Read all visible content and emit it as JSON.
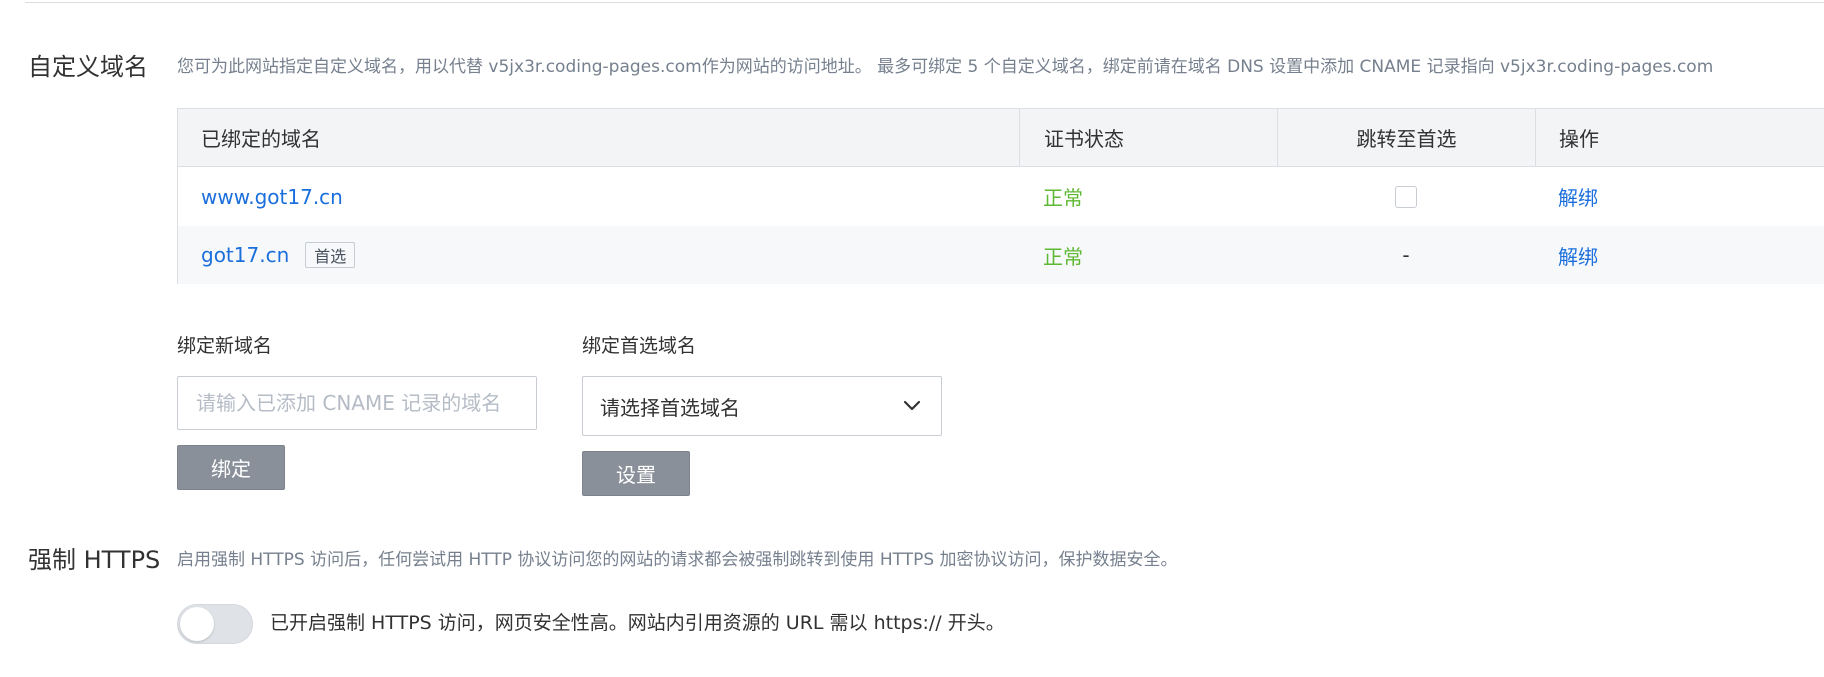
{
  "custom_domain": {
    "title": "自定义域名",
    "description": "您可为此网站指定自定义域名，用以代替 v5jx3r.coding-pages.com作为网站的访问地址。 最多可绑定 5 个自定义域名，绑定前请在域名 DNS 设置中添加 CNAME 记录指向 v5jx3r.coding-pages.com",
    "table": {
      "headers": [
        "已绑定的域名",
        "证书状态",
        "跳转至首选",
        "操作"
      ],
      "rows": [
        {
          "domain": "www.got17.cn",
          "tag": "",
          "cert_status": "正常",
          "redirect": "checkbox",
          "action": "解绑"
        },
        {
          "domain": "got17.cn",
          "tag": "首选",
          "cert_status": "正常",
          "redirect": "-",
          "action": "解绑"
        }
      ]
    },
    "bind_new": {
      "label": "绑定新域名",
      "placeholder": "请输入已添加 CNAME 记录的域名",
      "button": "绑定"
    },
    "bind_primary": {
      "label": "绑定首选域名",
      "selected": "请选择首选域名",
      "button": "设置"
    }
  },
  "force_https": {
    "title": "强制 HTTPS",
    "description": "启用强制 HTTPS 访问后，任何尝试用 HTTP 协议访问您的网站的请求都会被强制跳转到使用 HTTPS 加密协议访问，保护数据安全。",
    "toggle_on": false,
    "toggle_text": "已开启强制 HTTPS 访问，网页安全性高。网站内引用资源的 URL 需以 https:// 开头。"
  },
  "colors": {
    "link": "#1b6fdc",
    "status_ok": "#5fb833",
    "button_disabled": "#8a9099"
  }
}
